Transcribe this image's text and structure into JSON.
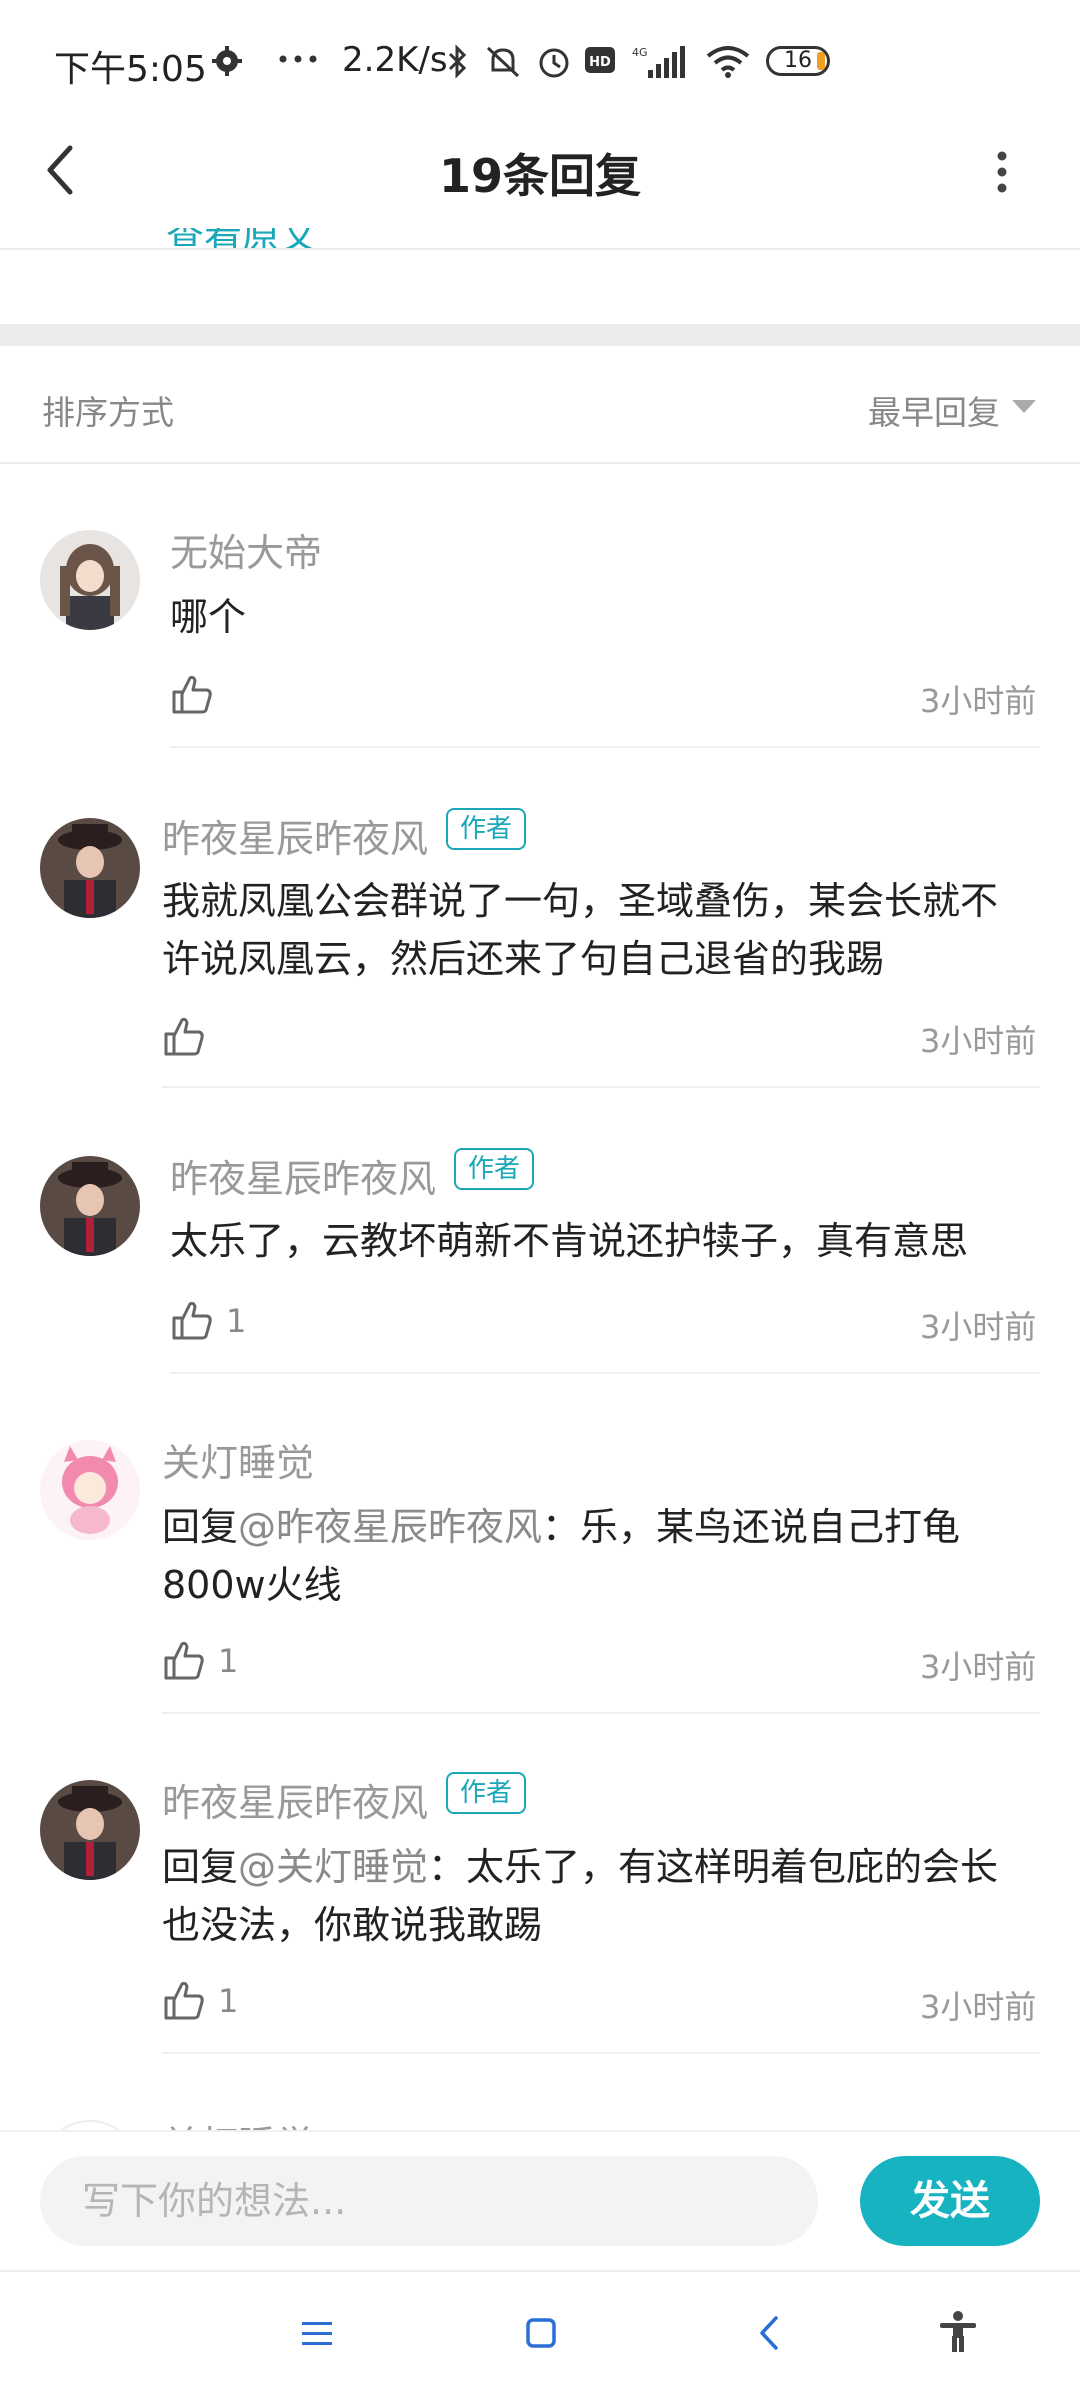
{
  "status_bar": {
    "time": "下午5:05",
    "speed": "2.2K/s",
    "battery": "16",
    "icons": [
      "gear-icon",
      "more-dots-icon",
      "bluetooth-icon",
      "mute-icon",
      "alarm-icon",
      "hd-icon",
      "signal-icon",
      "wifi-icon",
      "battery-icon"
    ]
  },
  "header": {
    "title": "19条回复",
    "partial_link": "查看原文"
  },
  "sort": {
    "label": "排序方式",
    "value": "最早回复"
  },
  "comments": [
    {
      "name": "无始大帝",
      "badge": "",
      "content": "哪个",
      "mention": "",
      "likes": "",
      "time": "3小时前"
    },
    {
      "name": "昨夜星辰昨夜风",
      "badge": "作者",
      "content_line1": "我就凤凰公会群说了一句，圣域叠伤，某会长就不",
      "content_line2": "许说凤凰云，然后还来了句自己退省的我踢",
      "likes": "",
      "time": "3小时前"
    },
    {
      "name": "昨夜星辰昨夜风",
      "badge": "作者",
      "content": "太乐了，云教坏萌新不肯说还护犊子，真有意思",
      "likes": "1",
      "time": "3小时前"
    },
    {
      "name": "关灯睡觉",
      "badge": "",
      "reply_prefix": "回复",
      "mention": "@昨夜星辰昨夜风",
      "content_line1": "：乐，某鸟还说自己打龟",
      "content_line2": "800w火线",
      "likes": "1",
      "time": "3小时前"
    },
    {
      "name": "昨夜星辰昨夜风",
      "badge": "作者",
      "reply_prefix": "回复",
      "mention": "@关灯睡觉",
      "content_line1": "：太乐了，有这样明着包庇的会长",
      "content_line2": "也没法，你敢说我敢踢",
      "likes": "1",
      "time": "3小时前"
    },
    {
      "name": "关灯睡觉"
    }
  ],
  "input": {
    "placeholder": "写下你的想法...",
    "send_label": "发送"
  },
  "colors": {
    "accent": "#17b3c1",
    "badge": "#1aa7b8",
    "name_gray": "#999999"
  }
}
